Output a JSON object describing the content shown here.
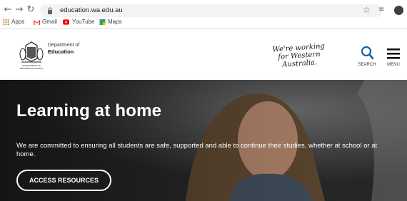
{
  "browser": {
    "url": "education.wa.edu.au",
    "bookmarks": [
      {
        "label": "Apps",
        "icon": "apps-grid-icon",
        "color": "#e8710a"
      },
      {
        "label": "Gmail",
        "icon": "gmail-icon",
        "color": "#ea4335"
      },
      {
        "label": "YouTube",
        "icon": "youtube-icon",
        "color": "#ff0000"
      },
      {
        "label": "Maps",
        "icon": "maps-icon",
        "color": "#34a853"
      }
    ]
  },
  "header": {
    "org_line1": "Department of",
    "org_line2": "Education",
    "crest_text_line1": "GOVERNMENT OF",
    "crest_text_line2": "WESTERN AUSTRALIA",
    "tagline": "We're working for Western Australia.",
    "search_label": "SEARCH",
    "menu_label": "MENU",
    "accent_color": "#1a5fa8"
  },
  "hero": {
    "title": "Learning at home",
    "text": "We are committed to ensuring all students are safe, supported and able to continue their studies, whether at school or at home.",
    "cta_label": "ACCESS RESOURCES"
  }
}
